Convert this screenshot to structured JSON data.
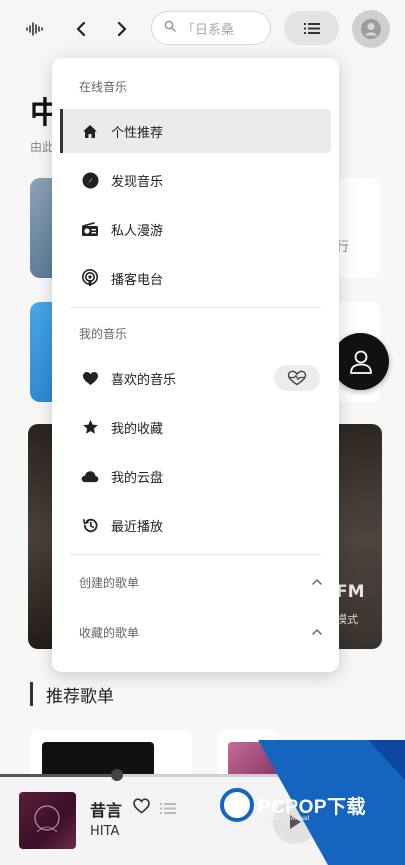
{
  "search": {
    "text": "「日系桑"
  },
  "background": {
    "title": "中",
    "subtitle": "由此",
    "card_right_fragment": "行",
    "fm_label": "FM",
    "fm_sub": "模式",
    "section_title": "推荐歌单"
  },
  "menu": {
    "online_header": "在线音乐",
    "online_items": [
      {
        "label": "个性推荐",
        "icon": "home-icon",
        "active": true
      },
      {
        "label": "发现音乐",
        "icon": "disc-icon"
      },
      {
        "label": "私人漫游",
        "icon": "radio-icon"
      },
      {
        "label": "播客电台",
        "icon": "podcast-icon"
      }
    ],
    "mine_header": "我的音乐",
    "mine_items": [
      {
        "label": "喜欢的音乐",
        "icon": "heart-icon"
      },
      {
        "label": "我的收藏",
        "icon": "star-icon"
      },
      {
        "label": "我的云盘",
        "icon": "cloud-icon"
      },
      {
        "label": "最近播放",
        "icon": "history-icon"
      }
    ],
    "created_playlists": "创建的歌单",
    "collected_playlists": "收藏的歌单"
  },
  "player": {
    "title": "昔言",
    "artist": "HITA",
    "progress": 0.29
  },
  "watermark": {
    "brand": "PCPOP下载",
    "sub": "PCPOP Download"
  }
}
